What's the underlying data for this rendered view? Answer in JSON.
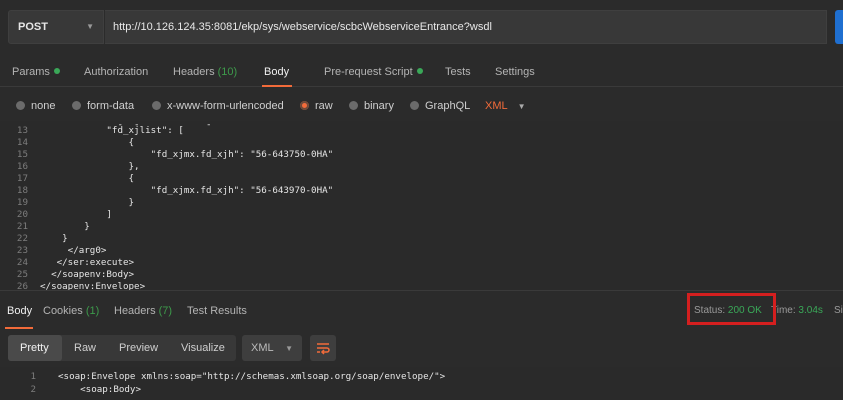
{
  "request": {
    "method": "POST",
    "url": "http://10.126.124.35:8081/ekp/sys/webservice/scbcWebserviceEntrance?wsdl"
  },
  "request_tabs": [
    {
      "label": "Params",
      "dot": true
    },
    {
      "label": "Authorization"
    },
    {
      "label": "Headers",
      "count": "(10)"
    },
    {
      "label": "Body",
      "active": true
    },
    {
      "label": "Pre-request Script",
      "dot": true
    },
    {
      "label": "Tests"
    },
    {
      "label": "Settings"
    }
  ],
  "body_types": [
    "none",
    "form-data",
    "x-www-form-urlencoded",
    "raw",
    "binary",
    "GraphQL"
  ],
  "body_type_selected": "raw",
  "raw_format": "XML",
  "editor_lines": [
    {
      "n": "13",
      "text": "            \"fd_xjlist\": ["
    },
    {
      "n": "14",
      "text": "                {"
    },
    {
      "n": "15",
      "text": "                    \"fd_xjmx.fd_xjh\": \"56-643750-0HA\""
    },
    {
      "n": "16",
      "text": "                },"
    },
    {
      "n": "17",
      "text": "                {"
    },
    {
      "n": "18",
      "text": "                    \"fd_xjmx.fd_xjh\": \"56-643970-0HA\""
    },
    {
      "n": "19",
      "text": "                }"
    },
    {
      "n": "20",
      "text": "            ]"
    },
    {
      "n": "21",
      "text": "        }"
    },
    {
      "n": "22",
      "text": "    }"
    },
    {
      "n": "23",
      "text": "     </arg0>"
    },
    {
      "n": "24",
      "text": "   </ser:execute>"
    },
    {
      "n": "25",
      "text": "  </soapenv:Body>"
    },
    {
      "n": "26",
      "text": "</soapenv:Envelope>"
    }
  ],
  "response_tabs": [
    {
      "label": "Body",
      "active": true
    },
    {
      "label": "Cookies",
      "count": "(1)"
    },
    {
      "label": "Headers",
      "count": "(7)"
    },
    {
      "label": "Test Results"
    }
  ],
  "status": {
    "label": "Status:",
    "value": "200 OK",
    "time_label": "Time:",
    "time_value": "3.04s",
    "size_label": "Si"
  },
  "view_modes": [
    "Pretty",
    "Raw",
    "Preview",
    "Visualize"
  ],
  "view_mode_selected": "Pretty",
  "response_format": "XML",
  "response_lines": [
    {
      "n": "1",
      "text": "<soap:Envelope xmlns:soap=\"http://schemas.xmlsoap.org/soap/envelope/\">"
    },
    {
      "n": "2",
      "text": "    <soap:Body>"
    }
  ],
  "colors": {
    "accent": "#f26b3a",
    "ok_green": "#3aa858",
    "highlight_red": "#d41f1f",
    "send_blue": "#1f6fd0"
  }
}
